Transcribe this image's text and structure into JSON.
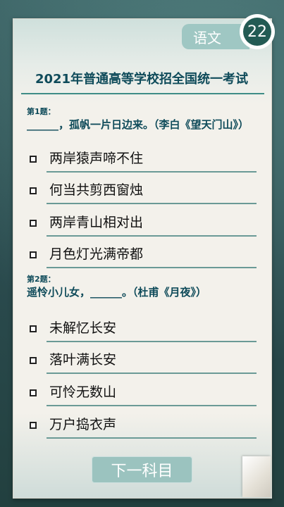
{
  "header": {
    "subject": "语文",
    "timer": "22"
  },
  "exam_title": "2021年普通高等学校招全国统一考试",
  "questions": [
    {
      "label": "第1题：",
      "text": "______，孤帆一片日边来。（李白《望天门山》）",
      "options": [
        "两岸猿声啼不住",
        "何当共剪西窗烛",
        "两岸青山相对出",
        "月色灯光满帝都"
      ]
    },
    {
      "label": "第2题：",
      "text": "遥怜小儿女，______。（杜甫《月夜》）",
      "options": [
        "未解忆长安",
        "落叶满长安",
        "可怜无数山",
        "万户捣衣声"
      ]
    }
  ],
  "next_button": "下一科目"
}
